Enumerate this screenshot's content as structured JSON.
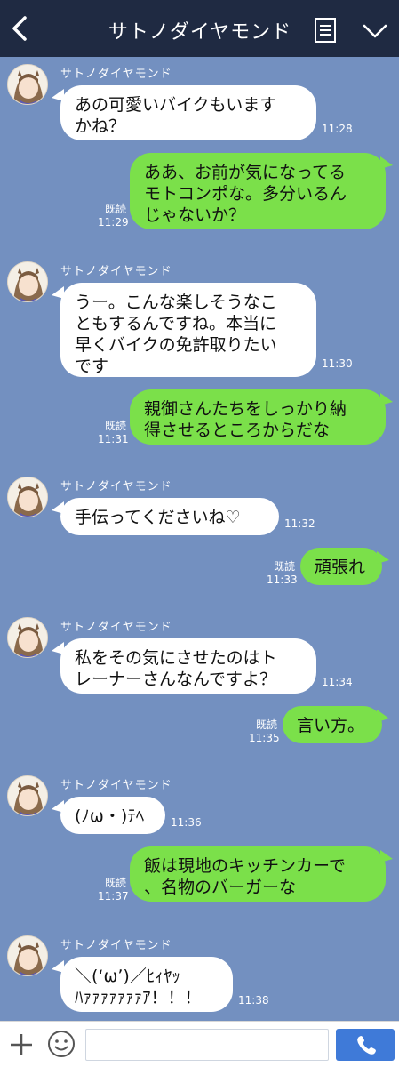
{
  "header": {
    "title": "サトノダイヤモンド",
    "back_icon": "chevron-left-icon",
    "menu_icon": "notes-icon",
    "collapse_icon": "chevron-down-icon"
  },
  "colors": {
    "background": "#7390c0",
    "header": "#1f2a42",
    "outgoing_bubble": "#7be04a",
    "incoming_bubble": "#ffffff",
    "send_button": "#3f7ad8"
  },
  "messages": [
    {
      "side": "left",
      "sender": "サトノダイヤモンド",
      "text": "あの可愛いバイクもいます\nかね？",
      "time": "11:28"
    },
    {
      "side": "right",
      "read": "既読",
      "text": "ああ、お前が気になってる\nモトコンポな。多分いるん\nじゃないか？",
      "time": "11:29"
    },
    {
      "side": "left",
      "sender": "サトノダイヤモンド",
      "text": "うー。こんな楽しそうなこ\nともするんですね。本当に\n早くバイクの免許取りたい\nです",
      "time": "11:30"
    },
    {
      "side": "right",
      "read": "既読",
      "text": "親御さんたちをしっかり納\n得させるところからだな",
      "time": "11:31"
    },
    {
      "side": "left",
      "sender": "サトノダイヤモンド",
      "text": "手伝ってくださいね♡",
      "time": "11:32"
    },
    {
      "side": "right",
      "read": "既読",
      "text": "頑張れ",
      "time": "11:33"
    },
    {
      "side": "left",
      "sender": "サトノダイヤモンド",
      "text": "私をその気にさせたのはト\nレーナーさんなんですよ？",
      "time": "11:34"
    },
    {
      "side": "right",
      "read": "既読",
      "text": "言い方。",
      "time": "11:35"
    },
    {
      "side": "left",
      "sender": "サトノダイヤモンド",
      "text": "(ﾉω・)ﾃﾍ",
      "time": "11:36"
    },
    {
      "side": "right",
      "read": "既読",
      "text": "飯は現地のキッチンカーで\n、名物のバーガーな",
      "time": "11:37"
    },
    {
      "side": "left",
      "sender": "サトノダイヤモンド",
      "text": "＼(ʻωʼ)／ﾋｨﾔｯ\nﾊｧｧｧｧｧｧｧｱ！！！",
      "time": "11:38"
    }
  ],
  "input_bar": {
    "placeholder": "",
    "plus_icon": "plus-icon",
    "emoji_icon": "smiley-icon",
    "call_icon": "phone-icon"
  }
}
